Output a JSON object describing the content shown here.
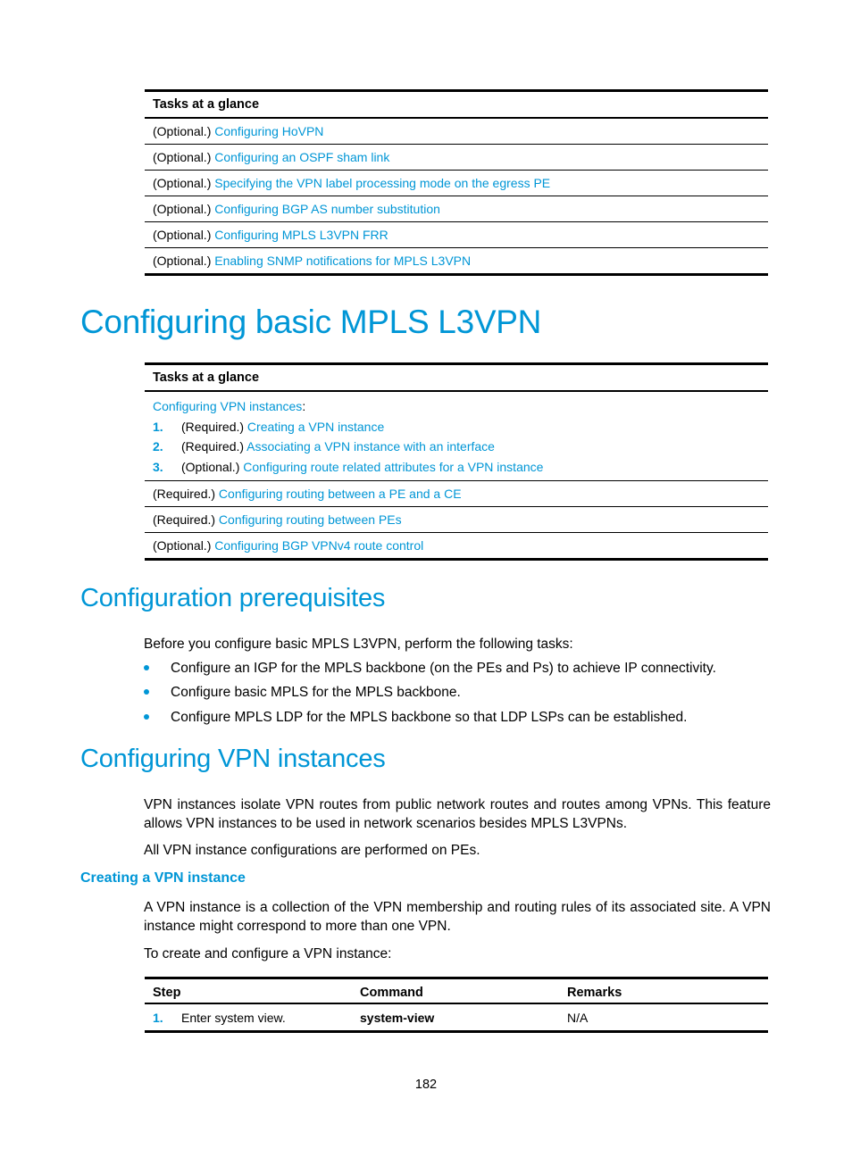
{
  "table1": {
    "header": "Tasks at a glance",
    "rows": [
      {
        "prefix": "(Optional.) ",
        "link": "Configuring HoVPN"
      },
      {
        "prefix": "(Optional.) ",
        "link": "Configuring an OSPF sham link"
      },
      {
        "prefix": "(Optional.) ",
        "link": "Specifying the VPN label processing mode on the egress PE"
      },
      {
        "prefix": "(Optional.) ",
        "link": "Configuring BGP AS number substitution"
      },
      {
        "prefix": "(Optional.) ",
        "link": "Configuring MPLS L3VPN FRR"
      },
      {
        "prefix": "(Optional.) ",
        "link": "Enabling SNMP notifications for MPLS L3VPN"
      }
    ]
  },
  "heading1": "Configuring basic MPLS L3VPN",
  "table2": {
    "header": "Tasks at a glance",
    "group": {
      "link": "Configuring VPN instances",
      "suffix": ":",
      "items": [
        {
          "num": "1.",
          "prefix": "(Required.) ",
          "link": "Creating a VPN instance"
        },
        {
          "num": "2.",
          "prefix": "(Required.) ",
          "link": "Associating a VPN instance with an interface"
        },
        {
          "num": "3.",
          "prefix": "(Optional.) ",
          "link": "Configuring route related attributes for a VPN instance"
        }
      ]
    },
    "rows": [
      {
        "prefix": "(Required.) ",
        "link": "Configuring routing between a PE and a CE"
      },
      {
        "prefix": "(Required.) ",
        "link": "Configuring routing between PEs"
      },
      {
        "prefix": "(Optional.) ",
        "link": "Configuring BGP VPNv4 route control"
      }
    ]
  },
  "prereq": {
    "heading": "Configuration prerequisites",
    "intro": "Before you configure basic MPLS L3VPN, perform the following tasks:",
    "bullets": [
      "Configure an IGP for the MPLS backbone (on the PEs and Ps) to achieve IP connectivity.",
      "Configure basic MPLS for the MPLS backbone.",
      "Configure MPLS LDP for the MPLS backbone so that LDP LSPs can be established."
    ]
  },
  "vpn": {
    "heading": "Configuring VPN instances",
    "para1": "VPN instances isolate VPN routes from public network routes and routes among VPNs. This feature allows VPN instances to be used in network scenarios besides MPLS L3VPNs.",
    "para2": "All VPN instance configurations are performed on PEs.",
    "sub_heading": "Creating a VPN instance",
    "para3": "A VPN instance is a collection of the VPN membership and routing rules of its associated site. A VPN instance might correspond to more than one VPN.",
    "para4": "To create and configure a VPN instance:"
  },
  "steps_table": {
    "headers": [
      "Step",
      "Command",
      "Remarks"
    ],
    "rows": [
      {
        "num": "1.",
        "step": "Enter system view.",
        "command": "system-view",
        "remarks": "N/A"
      }
    ]
  },
  "page_number": "182"
}
